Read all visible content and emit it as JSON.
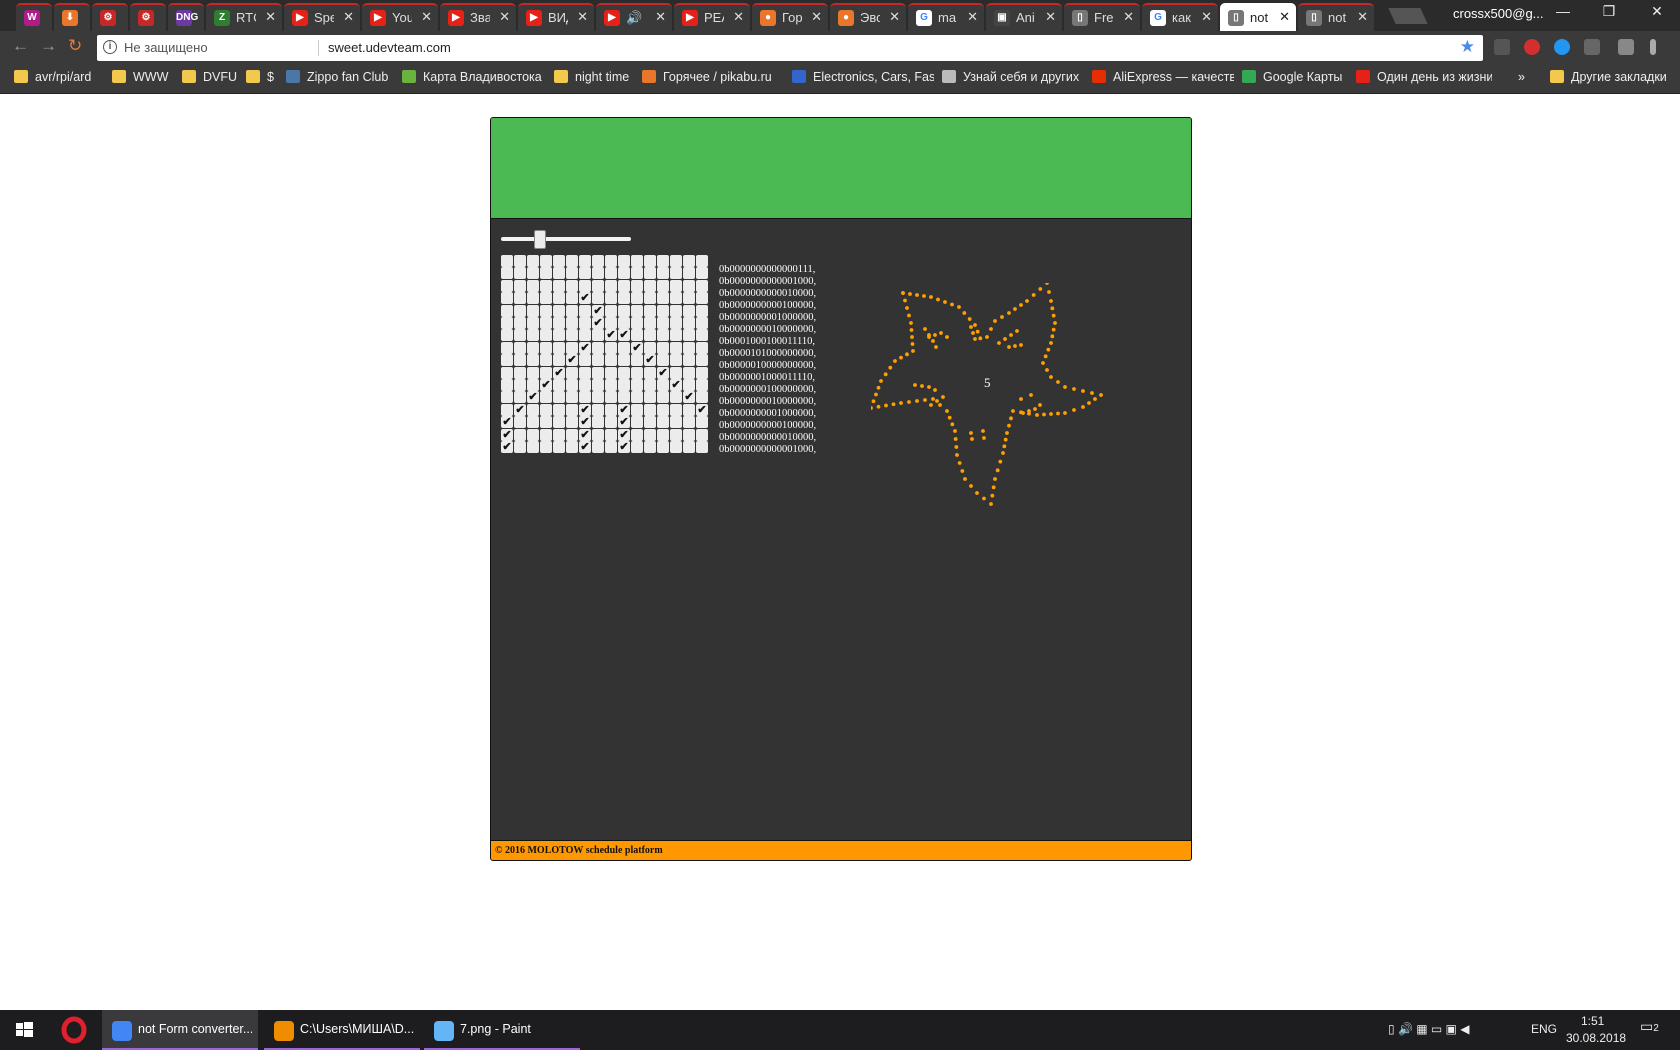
{
  "browser": {
    "tabs": [
      {
        "label": "",
        "icon": "w-icon",
        "color": "#b01b8a",
        "glyph": "W"
      },
      {
        "label": "",
        "icon": "download-icon",
        "color": "#e8762b",
        "glyph": "⬇"
      },
      {
        "label": "",
        "icon": "red-gear-icon",
        "color": "#c62828",
        "glyph": "⚙"
      },
      {
        "label": "",
        "icon": "red-gear-icon",
        "color": "#c62828",
        "glyph": "⚙"
      },
      {
        "label": "",
        "icon": "dng-icon",
        "color": "#6a3aa0",
        "glyph": "DNG"
      },
      {
        "label": "RTC",
        "icon": "z-icon",
        "color": "#2e7d32",
        "glyph": "Z"
      },
      {
        "label": "Spe",
        "icon": "youtube-icon",
        "color": "#e62117",
        "glyph": "▶"
      },
      {
        "label": "You",
        "icon": "youtube-icon",
        "color": "#e62117",
        "glyph": "▶"
      },
      {
        "label": "Зва",
        "icon": "youtube-icon",
        "color": "#e62117",
        "glyph": "▶"
      },
      {
        "label": "ВИД",
        "icon": "youtube-icon",
        "color": "#e62117",
        "glyph": "▶"
      },
      {
        "label": "🔊",
        "icon": "youtube-icon",
        "color": "#e62117",
        "glyph": "▶"
      },
      {
        "label": "РЕА",
        "icon": "youtube-icon",
        "color": "#e62117",
        "glyph": "▶"
      },
      {
        "label": "Гор",
        "icon": "pikabu-icon",
        "color": "#e8762b",
        "glyph": "●"
      },
      {
        "label": "Эво",
        "icon": "pikabu-icon",
        "color": "#e8762b",
        "glyph": "●"
      },
      {
        "label": "ma",
        "icon": "google-icon",
        "color": "#ffffff",
        "glyph": "G"
      },
      {
        "label": "Ani",
        "icon": "android-icon",
        "color": "#444444",
        "glyph": "▣"
      },
      {
        "label": "Free",
        "icon": "page-icon",
        "color": "#777777",
        "glyph": "▯"
      },
      {
        "label": "как",
        "icon": "google-icon",
        "color": "#ffffff",
        "glyph": "G"
      },
      {
        "label": "not",
        "icon": "page-icon",
        "color": "#777777",
        "glyph": "▯",
        "active": true
      },
      {
        "label": "not",
        "icon": "page-icon",
        "color": "#777777",
        "glyph": "▯"
      }
    ],
    "tab_close": "✕",
    "profile": "crossx500@g...",
    "window_controls": [
      "—",
      "❐",
      "✕"
    ],
    "nav": {
      "back": "←",
      "forward": "→",
      "reload": "↻"
    },
    "address": {
      "security_label": "Не защищено",
      "url": "sweet.udevteam.com",
      "info_glyph": "i",
      "star_glyph": "★"
    },
    "bookmarks": [
      {
        "label": "avr/rpi/ard",
        "icon": "folder-icon",
        "color": "#f2c94c"
      },
      {
        "label": "WWW",
        "icon": "folder-icon",
        "color": "#f2c94c"
      },
      {
        "label": "DVFU",
        "icon": "folder-icon",
        "color": "#f2c94c"
      },
      {
        "label": "$",
        "icon": "folder-icon",
        "color": "#f2c94c"
      },
      {
        "label": "Zippo fan Club",
        "icon": "vk-icon",
        "color": "#4a76a8"
      },
      {
        "label": "Карта Владивостока",
        "icon": "2gis-icon",
        "color": "#6bb33f"
      },
      {
        "label": "night time",
        "icon": "folder-icon",
        "color": "#f2c94c"
      },
      {
        "label": "Горячее / pikabu.ru",
        "icon": "pikabu-icon",
        "color": "#e8762b"
      },
      {
        "label": "Electronics, Cars, Fas",
        "icon": "ebay-icon",
        "color": "#3366cc"
      },
      {
        "label": "Узнай себя и других",
        "icon": "grid-icon",
        "color": "#bbbbbb"
      },
      {
        "label": "AliExpress — качеств",
        "icon": "aliexpress-icon",
        "color": "#e62e04"
      },
      {
        "label": "Google Карты",
        "icon": "maps-icon",
        "color": "#34a853"
      },
      {
        "label": "Один день из жизни",
        "icon": "youtube-icon",
        "color": "#e62117"
      }
    ],
    "more_glyph": "»",
    "other_bookmarks": "Другие закладки"
  },
  "app": {
    "slider": {
      "value": 0.3
    },
    "grid": {
      "rows": [
        "0000000000000000",
        "0000000000000000",
        "0000000000000000",
        "0000000000000000",
        "0000000000000000",
        "0000000000000000",
        "0000000000000000",
        "0000000000000000",
        "0000000000000000",
        "0000000000000000",
        "0000000000000000",
        "0000000000000000",
        "0000000000000000",
        "0000000000000000",
        "0000000000000000",
        "0000000000000000"
      ],
      "checked": [
        [
          3,
          6
        ],
        [
          4,
          7
        ],
        [
          5,
          7
        ],
        [
          6,
          8
        ],
        [
          6,
          9
        ],
        [
          7,
          6
        ],
        [
          7,
          10
        ],
        [
          8,
          5
        ],
        [
          8,
          11
        ],
        [
          9,
          4
        ],
        [
          9,
          12
        ],
        [
          10,
          3
        ],
        [
          10,
          13
        ],
        [
          11,
          2
        ],
        [
          11,
          14
        ],
        [
          12,
          1
        ],
        [
          12,
          6
        ],
        [
          12,
          9
        ],
        [
          12,
          15
        ],
        [
          13,
          0
        ],
        [
          13,
          6
        ],
        [
          13,
          9
        ],
        [
          14,
          0
        ],
        [
          14,
          6
        ],
        [
          14,
          9
        ],
        [
          15,
          0
        ],
        [
          15,
          6
        ],
        [
          15,
          9
        ]
      ]
    },
    "codes": [
      "0b0000000000000111,",
      "0b0000000000001000,",
      "0b0000000000010000,",
      "0b0000000000100000,",
      "0b0000000001000000,",
      "0b0000000010000000,",
      "0b0001000100011110,",
      "0b0000101000000000,",
      "0b0000010000000000,",
      "0b0000001000011110,",
      "0b0000000100000000,",
      "0b0000000010000000,",
      "0b0000000001000000,",
      "0b0000000000100000,",
      "0b0000000000010000,",
      "0b0000000000001000,"
    ],
    "flower_label": "5",
    "dot_color": "#ffa000",
    "footer": "© 2016 MOLOTOW schedule platform"
  },
  "taskbar": {
    "items": [
      {
        "label": "not Form converter...",
        "icon": "chrome-icon",
        "color": "#4285f4"
      },
      {
        "label": "C:\\Users\\МИША\\D...",
        "icon": "sublime-icon",
        "color": "#f08c00"
      },
      {
        "label": "7.png - Paint",
        "icon": "paint-icon",
        "color": "#64b5f6"
      }
    ],
    "lang": "ENG",
    "time": "1:51",
    "date": "30.08.2018",
    "notifications": "2"
  }
}
